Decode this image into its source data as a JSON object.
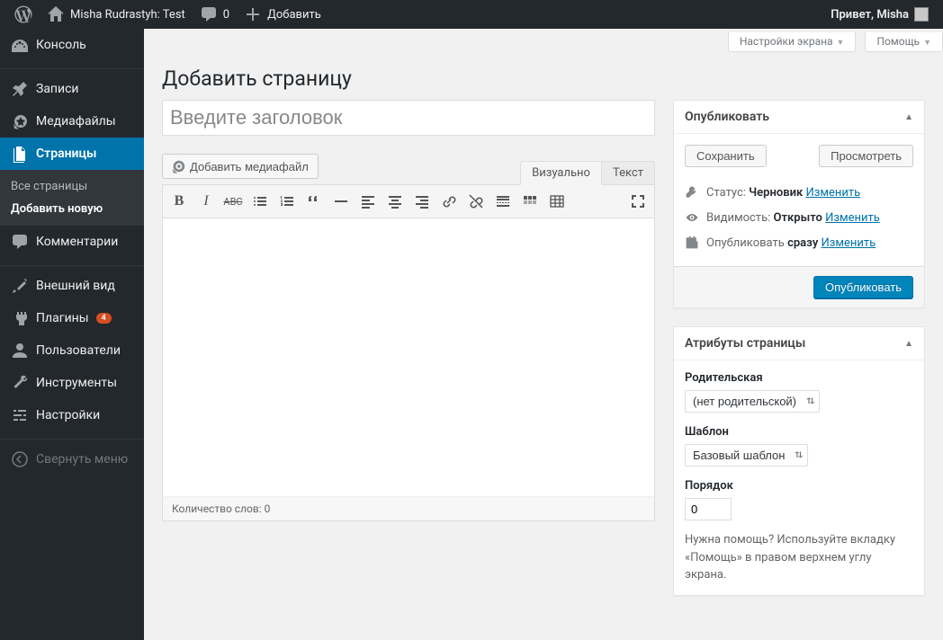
{
  "adminbar": {
    "site_name": "Misha Rudrastyh: Test",
    "comments_count": "0",
    "add_new": "Добавить",
    "greeting": "Привет, Misha"
  },
  "sidebar": {
    "items": [
      {
        "label": "Консоль"
      },
      {
        "label": "Записи"
      },
      {
        "label": "Медиафайлы"
      },
      {
        "label": "Страницы"
      },
      {
        "label": "Комментарии"
      },
      {
        "label": "Внешний вид"
      },
      {
        "label": "Плагины",
        "badge": "4"
      },
      {
        "label": "Пользователи"
      },
      {
        "label": "Инструменты"
      },
      {
        "label": "Настройки"
      }
    ],
    "pages_submenu": {
      "all": "Все страницы",
      "add": "Добавить новую"
    },
    "collapse": "Свернуть меню"
  },
  "screen_meta": {
    "screen_options": "Настройки экрана",
    "help": "Помощь"
  },
  "page": {
    "heading": "Добавить страницу",
    "title_placeholder": "Введите заголовок"
  },
  "editor": {
    "add_media": "Добавить медиафайл",
    "tab_visual": "Визуально",
    "tab_text": "Текст",
    "word_count": "Количество слов: 0"
  },
  "publish": {
    "box_title": "Опубликовать",
    "save_draft": "Сохранить",
    "preview": "Просмотреть",
    "status_label": "Статус:",
    "status_value": "Черновик",
    "visibility_label": "Видимость:",
    "visibility_value": "Открыто",
    "schedule_label": "Опубликовать",
    "schedule_value": "сразу",
    "edit_link": "Изменить",
    "publish_button": "Опубликовать"
  },
  "attributes": {
    "box_title": "Атрибуты страницы",
    "parent_label": "Родительская",
    "parent_value": "(нет родительской)",
    "template_label": "Шаблон",
    "template_value": "Базовый шаблон",
    "order_label": "Порядок",
    "order_value": "0",
    "help_text": "Нужна помощь? Используйте вкладку «Помощь» в правом верхнем углу экрана."
  }
}
